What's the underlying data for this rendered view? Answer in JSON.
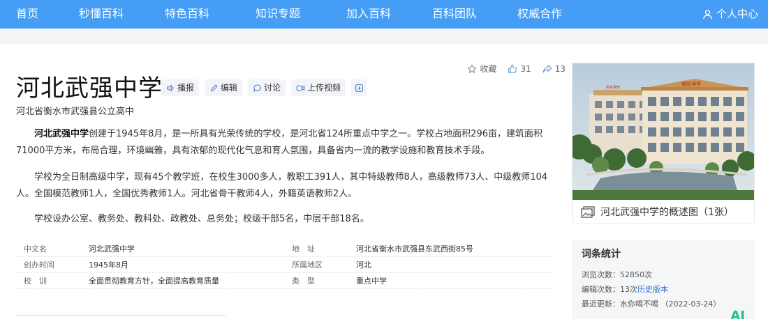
{
  "nav": {
    "items": [
      "首页",
      "秒懂百科",
      "特色百科",
      "知识专题",
      "加入百科",
      "百科团队",
      "权威合作"
    ],
    "user_center": "个人中心",
    "bg_color": "#459df5"
  },
  "header": {
    "title": "河北武强中学",
    "tools": [
      "播报",
      "编辑",
      "讨论",
      "上传视频"
    ],
    "subtitle": "河北省衡水市武强县公立高中"
  },
  "actions": {
    "favorite_label": "收藏",
    "like_count": "31",
    "share_count": "13"
  },
  "content": {
    "p1_bold": "河北武强中学",
    "p1_rest": "创建于1945年8月，是一所具有光荣传统的学校，是河北省124所重点中学之一。学校占地面积296亩，建筑面积71000平方米，布局合理，环境幽雅，具有浓郁的现代化气息和育人氛围，具备省内一流的教学设施和教育技术手段。",
    "p2": "学校为全日制高级中学，现有45个教学班，在校生3000多人，教职工391人，其中特级教师8人，高级教师73人、中级教师104人。全国模范教师1人，全国优秀教师1人。河北省骨干教师4人，外籍英语教师2人。",
    "p3": "学校设办公室、教务处、教科处、政教处、总务处；校级干部5名，中层干部18名。"
  },
  "infobox": [
    {
      "k1": "中文名",
      "v1": "河北武强中学",
      "k2": "地　址",
      "v2": "河北省衡水市武强县东武西街85号"
    },
    {
      "k1": "创办时间",
      "v1": "1945年8月",
      "k2": "所属地区",
      "v2": "河北"
    },
    {
      "k1": "校　训",
      "v1": "全面贯彻教育方针，全面提高教育质量",
      "k2": "类　型",
      "v2": "重点中学"
    }
  ],
  "album": {
    "caption": "河北武强中学的概述图（1张）",
    "building_sign": "坡前博学",
    "building_sign_small": "务实求知"
  },
  "stats": {
    "title": "词条统计",
    "views_label": "浏览次数：",
    "views": "52850次",
    "edits_label": "编辑次数：",
    "edits": "13次",
    "history_link": "历史版本",
    "updated_label": "最近更新：",
    "updated_by": "水你喝不喝",
    "updated_date": "（2022-03-24）",
    "corner_mark": "AI"
  }
}
